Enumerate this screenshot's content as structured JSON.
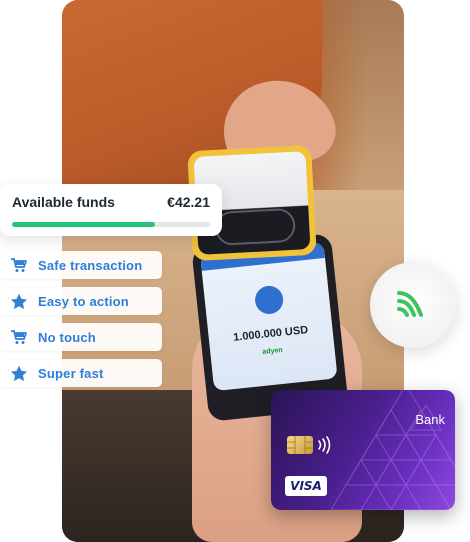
{
  "funds": {
    "label": "Available funds",
    "amount": "€42.21",
    "progress": 0.72
  },
  "features": [
    {
      "label": "Safe transaction",
      "icon": "cart-icon"
    },
    {
      "label": "Easy to action",
      "icon": "star-icon"
    },
    {
      "label": "No touch",
      "icon": "cart-icon"
    },
    {
      "label": "Super fast",
      "icon": "star-icon"
    }
  ],
  "terminal": {
    "amount": "1.000.000 USD",
    "brand": "adyen"
  },
  "card": {
    "bank_name": "Bank",
    "network": "VISA"
  },
  "colors": {
    "accent": "#2e7fd6",
    "progress": "#25c27a",
    "nfc": "#3ec45c",
    "card": "#4a1f8e"
  }
}
